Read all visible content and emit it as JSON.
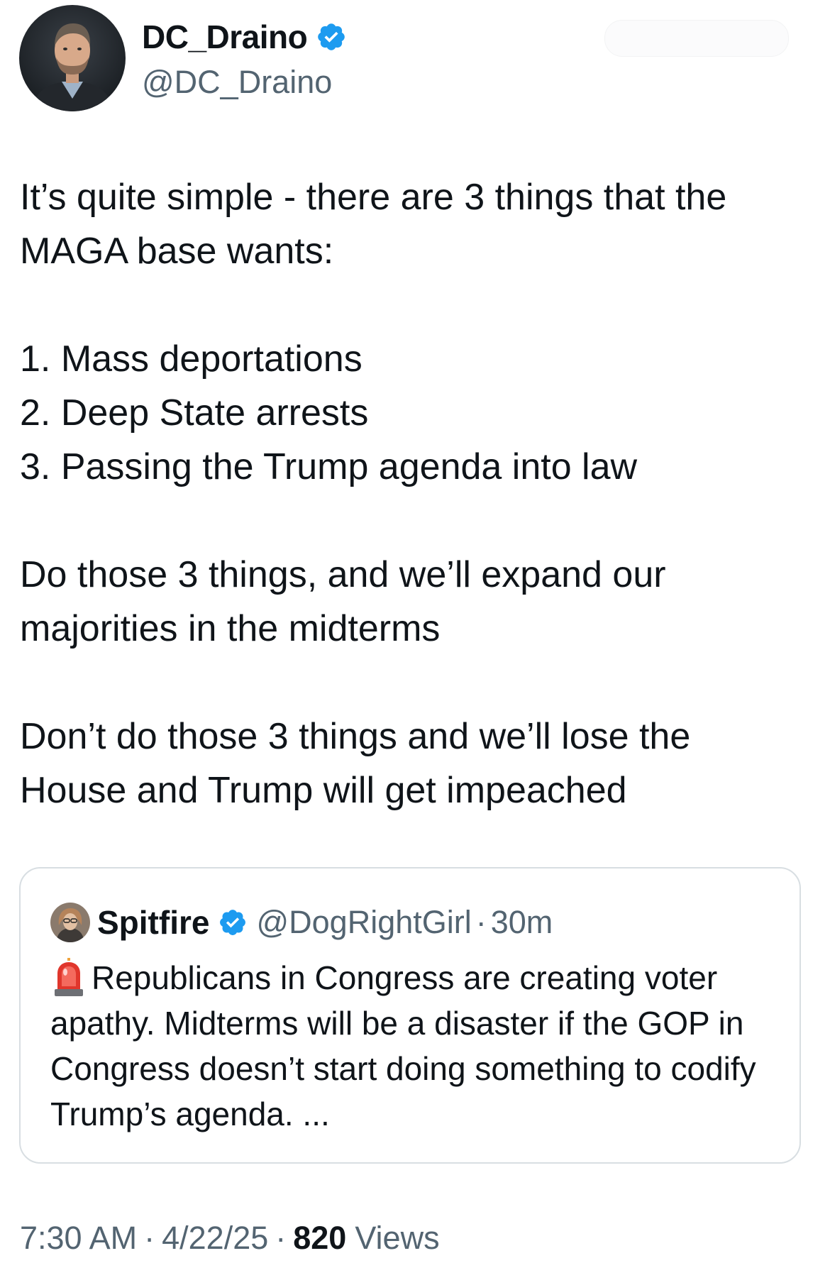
{
  "author": {
    "display_name": "DC_Draino",
    "handle": "@DC_Draino",
    "verified_icon": "verified-badge-icon",
    "avatar_icon": "profile-photo"
  },
  "follow_button": {
    "label": ""
  },
  "tweet": {
    "line1": "It’s quite simple - there are 3 things that the\nMAGA base wants:",
    "item1": "1. Mass deportations",
    "item2": "2. Deep State arrests",
    "item3": "3. Passing the Trump agenda into law",
    "para2": "Do those 3 things, and we’ll expand our\nmajorities in the midterms",
    "para3": "Don’t do those 3 things and we’ll lose the\nHouse and Trump will get impeached"
  },
  "quoted_tweet": {
    "display_name": "Spitfire",
    "handle": "@DogRightGirl",
    "separator": "·",
    "time": "30m",
    "emoji_icon": "siren-icon",
    "text": "Republicans in Congress are creating voter apathy. Midterms will be a disaster if the GOP in Congress doesn’t start doing something to codify Trump’s agenda. ..."
  },
  "meta": {
    "time": "7:30 AM",
    "separator": "·",
    "date": "4/22/25",
    "views_count": "820",
    "views_label": "Views"
  },
  "colors": {
    "text_primary": "#0f1419",
    "text_secondary": "#536471",
    "verified_blue": "#1d9bf0",
    "card_border": "#d8dee2"
  }
}
